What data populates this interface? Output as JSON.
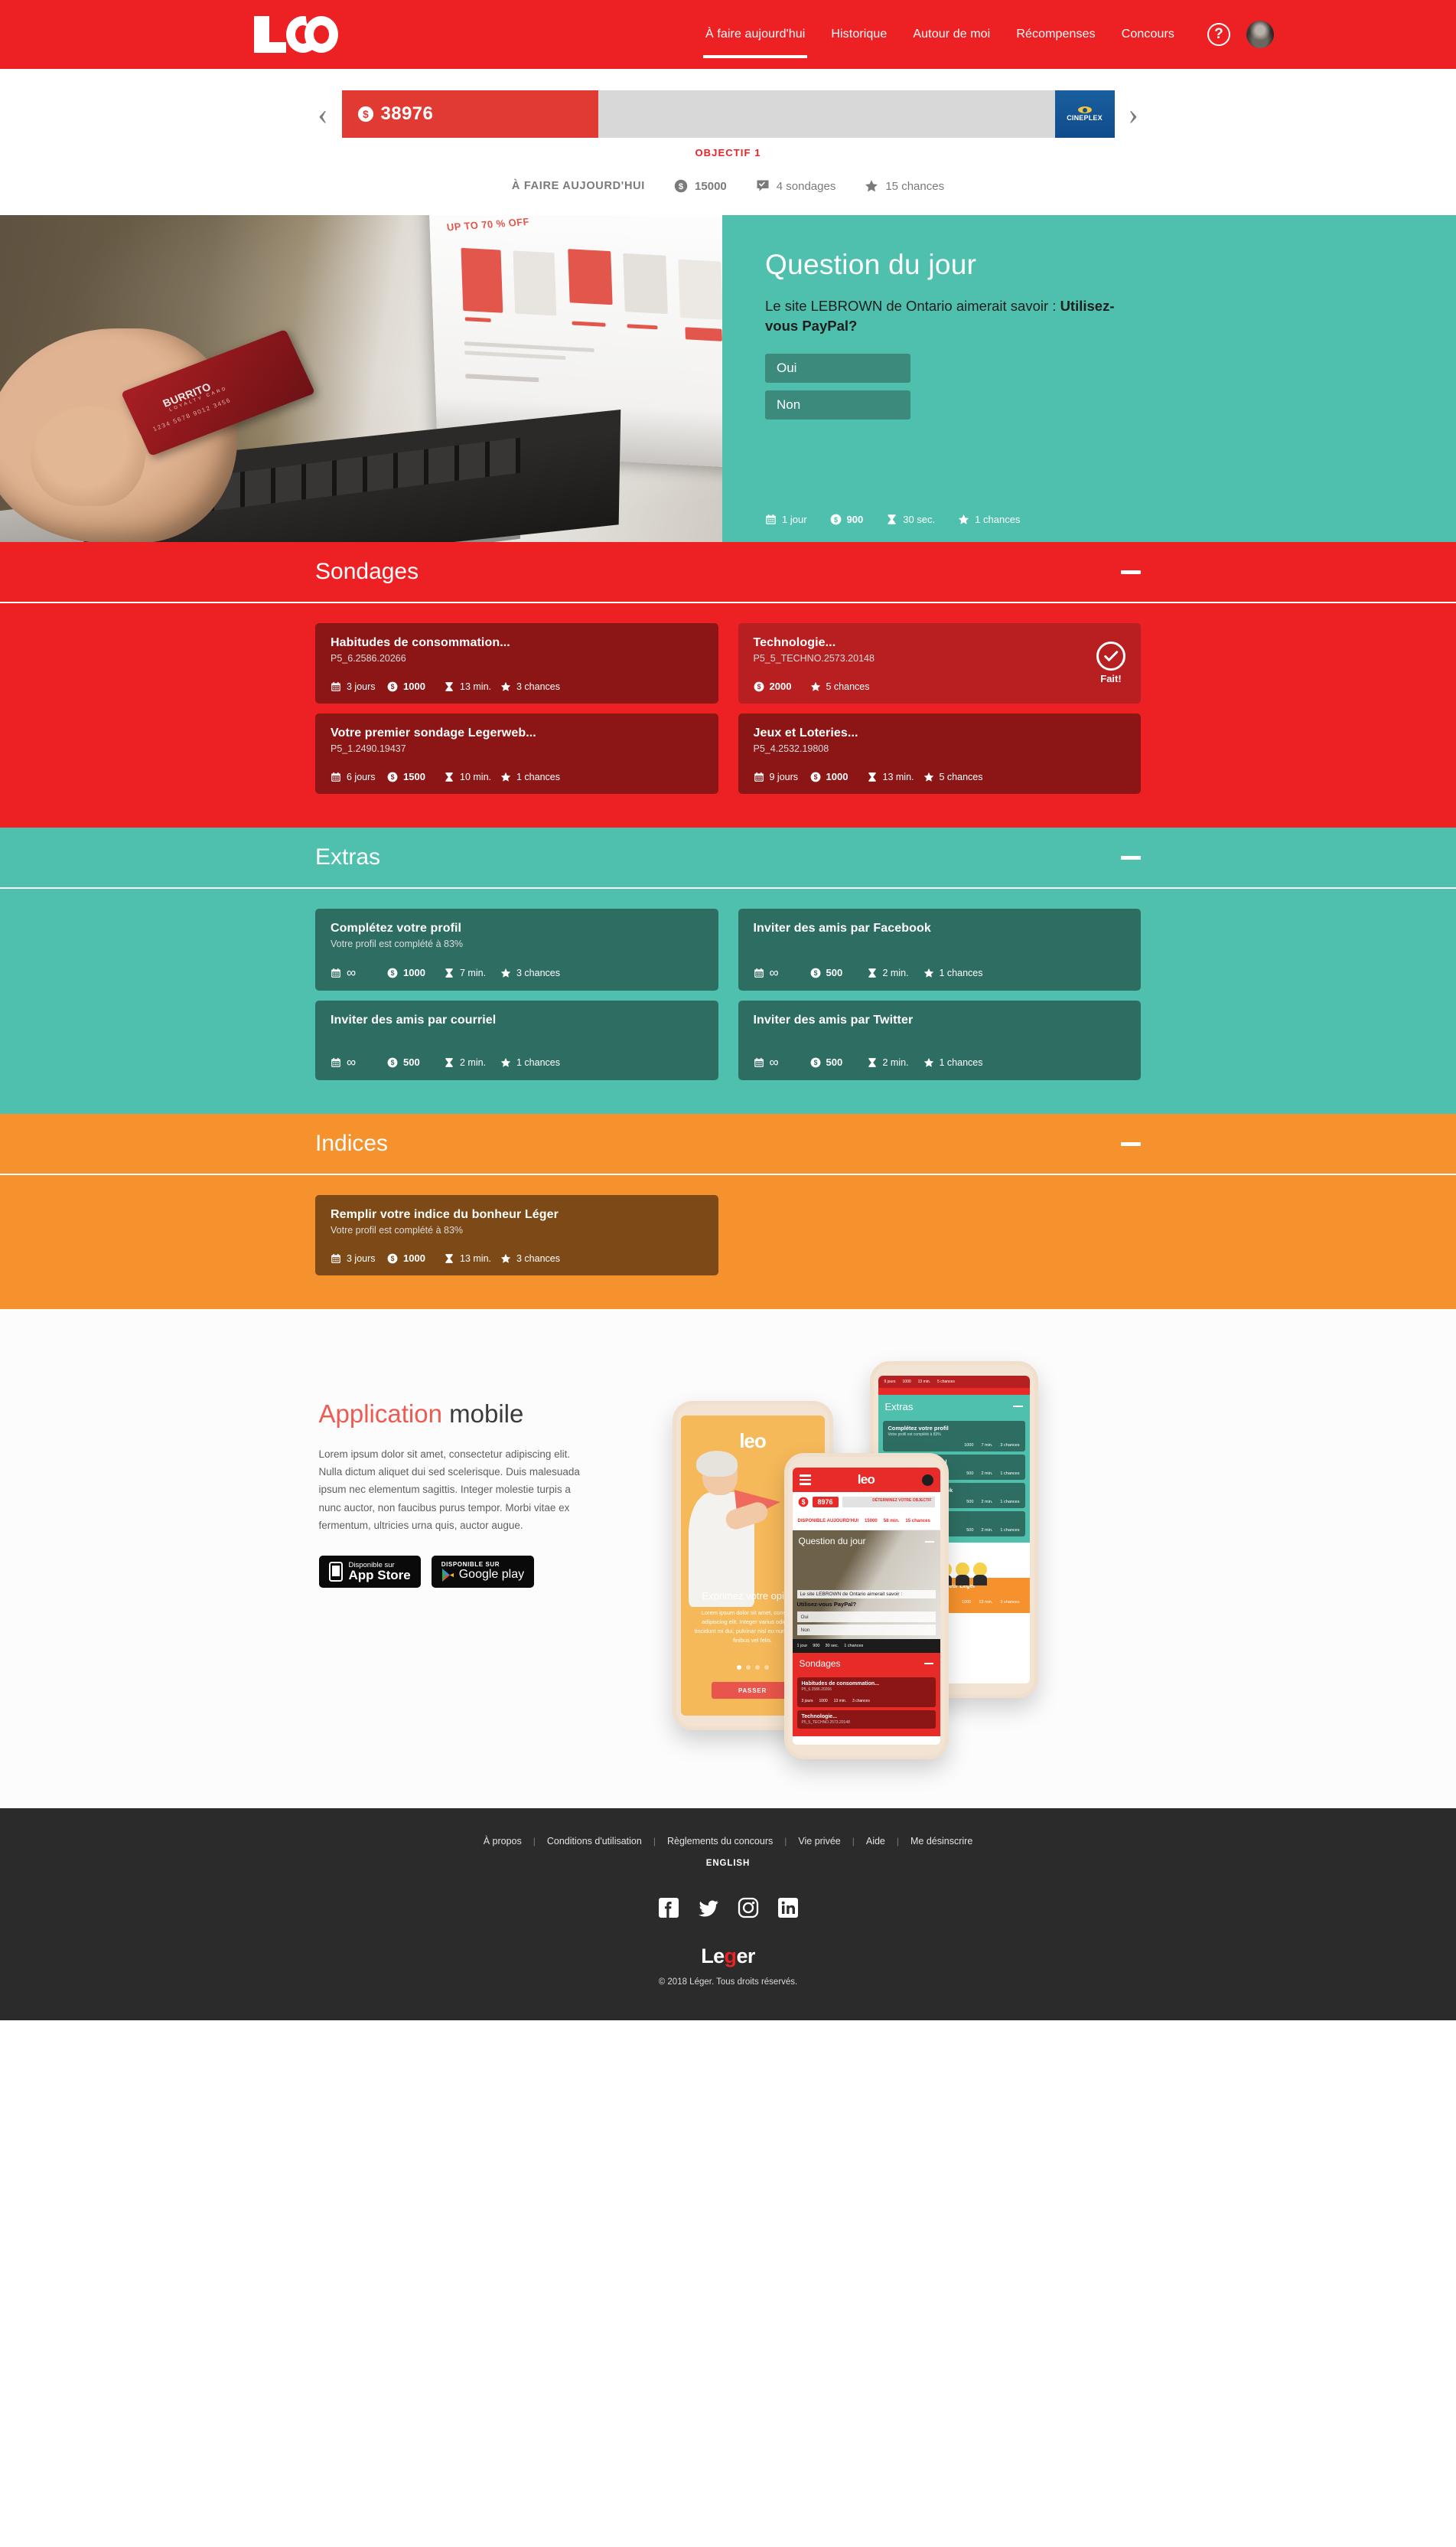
{
  "brand": {
    "logo_text": "leo",
    "accent_red": "#ed2024",
    "accent_teal": "#4ec0ad",
    "accent_orange": "#f6922d",
    "dark": "#2b2b2b"
  },
  "nav": {
    "items": [
      {
        "label": "À faire aujourd'hui",
        "active": true
      },
      {
        "label": "Historique",
        "active": false
      },
      {
        "label": "Autour de moi",
        "active": false
      },
      {
        "label": "Récompenses",
        "active": false
      },
      {
        "label": "Concours",
        "active": false
      }
    ],
    "help_label": "?",
    "avatar_name": "user-avatar"
  },
  "progress": {
    "prev_label": "‹",
    "next_label": "›",
    "points": "38976",
    "fill_percent": 33,
    "sponsor": "CINEPLEX",
    "objective_label": "OBJECTIF 1"
  },
  "today": {
    "label": "À FAIRE AUJOURD'HUI",
    "points": "15000",
    "surveys": "4 sondages",
    "chances": "15 chances"
  },
  "hero": {
    "title": "Question du jour",
    "prompt_prefix": "Le site LEBROWN de Ontario aimerait savoir : ",
    "prompt_bold": "Utilisez-vous PayPal?",
    "answers": [
      "Oui",
      "Non"
    ],
    "meta": {
      "days": "1 jour",
      "points": "900",
      "time": "30 sec.",
      "chances": "1 chances"
    }
  },
  "sections": [
    {
      "id": "sondages",
      "title": "Sondages",
      "cards": [
        {
          "title": "Habitudes de consommation...",
          "code": "P5_6.2586.20266",
          "days": "3 jours",
          "points": "1000",
          "time": "13 min.",
          "chances": "3 chances",
          "done": false
        },
        {
          "title": "Technologie...",
          "code": "P5_5_TECHNO.2573.20148",
          "days": "",
          "points": "2000",
          "time": "",
          "chances": "5 chances",
          "done": true,
          "done_label": "Fait!"
        },
        {
          "title": "Votre premier sondage Legerweb...",
          "code": "P5_1.2490.19437",
          "days": "6 jours",
          "points": "1500",
          "time": "10 min.",
          "chances": "1 chances",
          "done": false
        },
        {
          "title": "Jeux et Loteries...",
          "code": "P5_4.2532.19808",
          "days": "9 jours",
          "points": "1000",
          "time": "13 min.",
          "chances": "5 chances",
          "done": false
        }
      ]
    },
    {
      "id": "extras",
      "title": "Extras",
      "cards": [
        {
          "title": "Complétez votre profil",
          "code": "Votre profil est complété à 83%",
          "days": "∞",
          "points": "1000",
          "time": "7 min.",
          "chances": "3 chances",
          "done": false
        },
        {
          "title": "Inviter des amis par Facebook",
          "code": "",
          "days": "∞",
          "points": "500",
          "time": "2 min.",
          "chances": "1 chances",
          "done": false
        },
        {
          "title": "Inviter des amis par courriel",
          "code": "",
          "days": "∞",
          "points": "500",
          "time": "2 min.",
          "chances": "1 chances",
          "done": false
        },
        {
          "title": "Inviter des amis par Twitter",
          "code": "",
          "days": "∞",
          "points": "500",
          "time": "2 min.",
          "chances": "1 chances",
          "done": false
        }
      ]
    },
    {
      "id": "indices",
      "title": "Indices",
      "cards": [
        {
          "title": "Remplir votre indice du bonheur Léger",
          "code": "Votre profil est complété à 83%",
          "days": "3 jours",
          "points": "1000",
          "time": "13 min.",
          "chances": "3 chances",
          "done": false
        }
      ]
    }
  ],
  "app": {
    "title_red": "Application",
    "title_rest": " mobile",
    "body": "Lorem ipsum dolor sit amet, consectetur adipiscing elit. Nulla dictum aliquet dui sed scelerisque. Duis malesuada ipsum nec elementum sagittis. Integer molestie turpis a nunc auctor, non faucibus purus tempor. Morbi vitae ex fermentum, ultricies urna quis, auctor augue.",
    "appstore_small": "Disponible sur",
    "appstore_large": "App Store",
    "google_small": "DISPONIBLE SUR",
    "google_large": "Google play"
  },
  "phone_mock": {
    "p1": {
      "logo": "leo",
      "caption": "Exprimez votre opinion",
      "lorem": "Lorem ipsum dolor sit amet, consectetur adipiscing elit. Integer varius odio. Proin tincidunt mi dui, pulvinar nisl eu nunc posuere finibus vel felis.",
      "skip": "PASSER"
    },
    "p2": {
      "logo": "leo",
      "points": "8976",
      "goal_hint": "DÉTERMINEZ VOTRE OBJECTIF",
      "avail_label": "DISPONIBLE AUJOURD'HUI",
      "avail_points": "15000",
      "avail_time": "58 min.",
      "avail_chances": "15 chances",
      "qdj_title": "Question du jour",
      "qdj_q": "Le site LEBROWN de Ontario aimerait savoir :",
      "qdj_qb": "Utilisez-vous PayPal?",
      "opt1": "Oui",
      "opt2": "Non",
      "meta_days": "1 jour",
      "meta_points": "900",
      "meta_time": "30 sec.",
      "meta_chances": "1 chances",
      "sond_title": "Sondages",
      "card1_title": "Habitudes de consommation...",
      "card1_code": "P5_6.2586.20266",
      "card1_days": "3 jours",
      "card1_points": "1000",
      "card1_time": "13 min.",
      "card1_chances": "3 chances",
      "card2_title": "Technologie...",
      "card2_code": "P5_5_TECHNO.2573.20148"
    },
    "p3": {
      "top_days": "9 jours",
      "top_points": "1000",
      "top_time": "13 min.",
      "top_chances": "5 chances",
      "extras_title": "Extras",
      "c1_title": "Complétez votre profil",
      "c1_sub": "Votre profil est complété à 83%",
      "c1_points": "1000",
      "c1_time": "7 min.",
      "c1_chances": "3 chances",
      "c2_title": "...es amis par courriel",
      "c2_points": "500",
      "c2_time": "2 min.",
      "c2_chances": "1 chances",
      "c3_title": "...es amis par Facebook",
      "c3_points": "500",
      "c3_time": "2 min.",
      "c3_chances": "1 chances",
      "c4_title": "...es amis par Twitter",
      "c4_points": "500",
      "c4_time": "2 min.",
      "c4_chances": "1 chances",
      "i1_title": "...votre indice du bonheur Léger",
      "i1_sub": "...est complété à 83%",
      "i1_points": "1000",
      "i1_time": "13 min.",
      "i1_chances": "3 chances"
    }
  },
  "footer": {
    "links": [
      "À propos",
      "Conditions d'utilisation",
      "Règlements du concours",
      "Vie privée",
      "Aide",
      "Me désinscrire"
    ],
    "language": "ENGLISH",
    "social": [
      "facebook-icon",
      "twitter-icon",
      "instagram-icon",
      "linkedin-icon"
    ],
    "logo_pre": "Le",
    "logo_accent": "g",
    "logo_post": "er",
    "copyright": "© 2018 Léger. Tous droits réservés."
  }
}
